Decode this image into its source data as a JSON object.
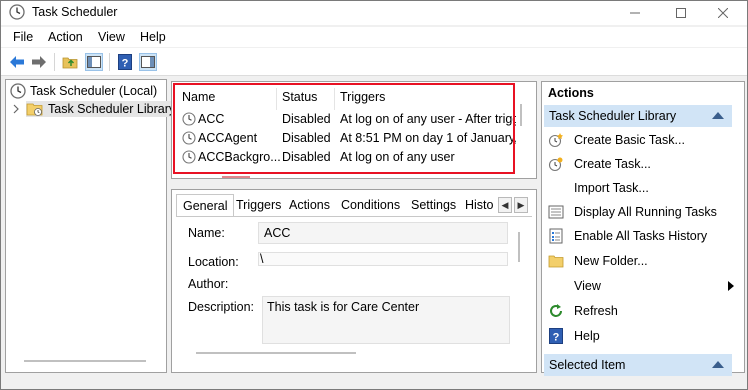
{
  "window": {
    "title": "Task Scheduler"
  },
  "menu": [
    "File",
    "Action",
    "View",
    "Help"
  ],
  "tree": {
    "root": "Task Scheduler (Local)",
    "child": "Task Scheduler Library"
  },
  "task_list": {
    "columns": [
      "Name",
      "Status",
      "Triggers"
    ],
    "rows": [
      {
        "name": "ACC",
        "status": "Disabled",
        "triggers": "At log on of any user - After trigg"
      },
      {
        "name": "ACCAgent",
        "status": "Disabled",
        "triggers": "At 8:51 PM on day 1 of January, I"
      },
      {
        "name": "ACCBackgro...",
        "status": "Disabled",
        "triggers": "At log on of any user"
      }
    ]
  },
  "details": {
    "tabs": [
      "General",
      "Triggers",
      "Actions",
      "Conditions",
      "Settings",
      "Histo"
    ],
    "name_label": "Name:",
    "name_value": "ACC",
    "location_label": "Location:",
    "location_value": "\\",
    "author_label": "Author:",
    "author_value": "",
    "description_label": "Description:",
    "description_value": "This task is for Care Center"
  },
  "actions": {
    "header": "Actions",
    "section_library": "Task Scheduler Library",
    "items": [
      {
        "label": "Create Basic Task...",
        "icon": "create-basic-task-icon"
      },
      {
        "label": "Create Task...",
        "icon": "create-task-icon"
      },
      {
        "label": "Import Task...",
        "icon": ""
      },
      {
        "label": "Display All Running Tasks",
        "icon": "running-tasks-icon"
      },
      {
        "label": "Enable All Tasks History",
        "icon": "tasks-history-icon"
      },
      {
        "label": "New Folder...",
        "icon": "folder-icon"
      },
      {
        "label": "View",
        "icon": ""
      },
      {
        "label": "Refresh",
        "icon": "refresh-icon"
      },
      {
        "label": "Help",
        "icon": "help-icon"
      }
    ],
    "section_selected": "Selected Item"
  },
  "colors": {
    "highlight_border": "#e81123",
    "section_bg": "#d1e4f6",
    "arrow_blue": "#2b79d8"
  }
}
